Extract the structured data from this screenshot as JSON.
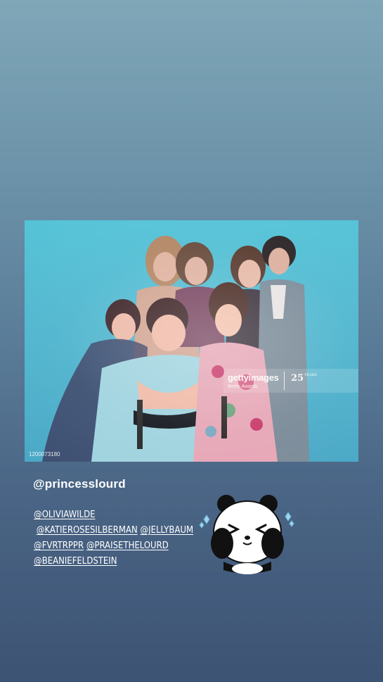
{
  "photo": {
    "watermark_brand": "gettyimages",
    "watermark_sub": "Berlin Awards",
    "watermark_anniversary": "25",
    "watermark_anniversary_small": "YEARS",
    "image_id": "1200073180"
  },
  "caption": {
    "main_handle": "@princesslourd",
    "lines": [
      [
        "@OLIVIAWILDE"
      ],
      [
        "@KATIEROSESILBERMAN",
        "@JELLYBAUM"
      ],
      [
        "@FVRTRPPR",
        "@PRAISETHELOURD"
      ],
      [
        "@BEANIEFELDSTEIN"
      ]
    ]
  },
  "sticker": {
    "icon": "panda-sticker"
  },
  "colors": {
    "background_top": "#7fa7b8",
    "background_bottom": "#3d5374",
    "photo_backdrop": "#4fb7cf",
    "text": "#ffffff"
  }
}
